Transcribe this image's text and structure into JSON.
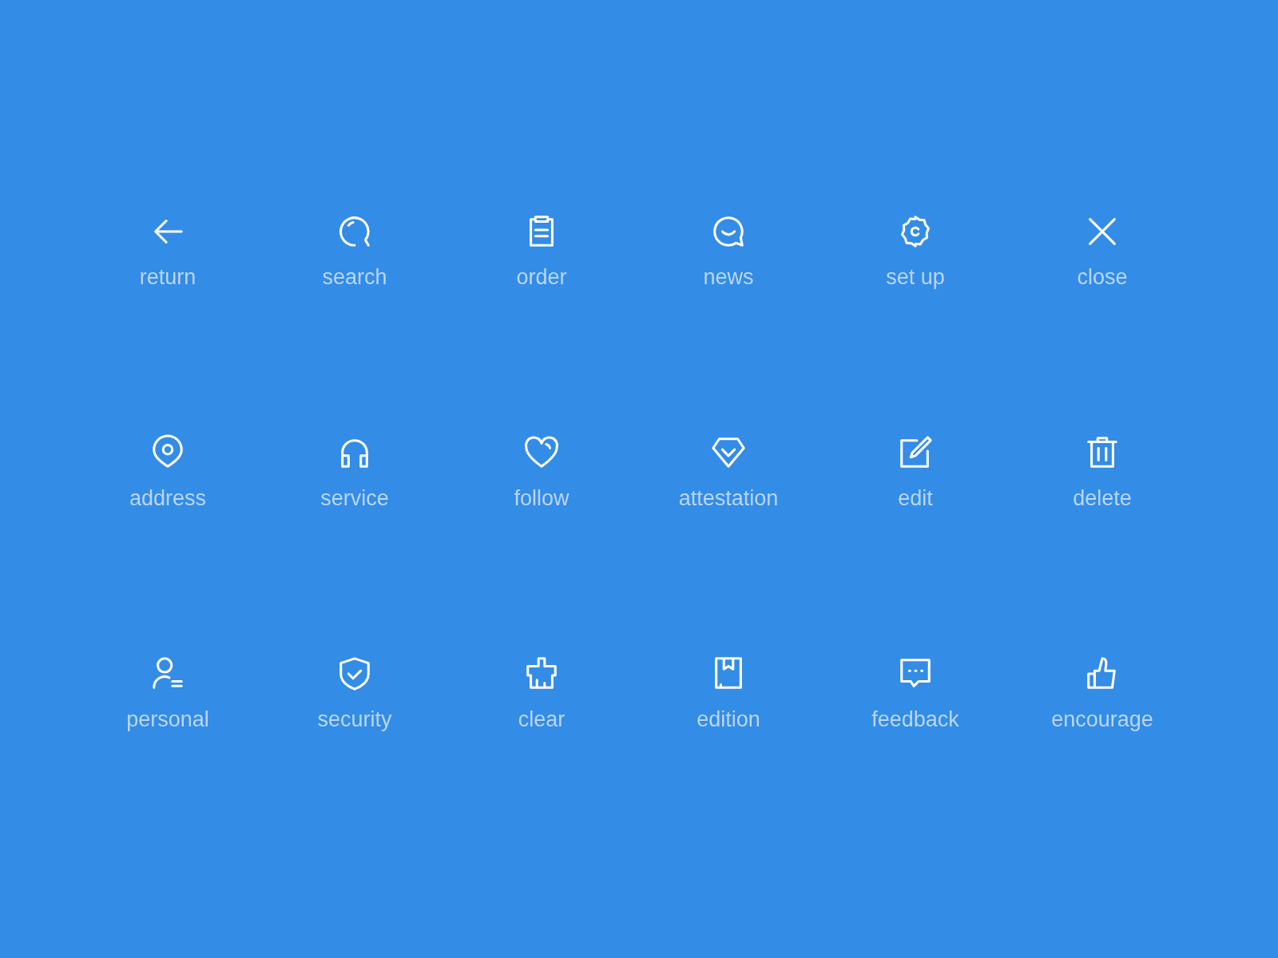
{
  "icons": [
    {
      "label": "return",
      "kind": "return"
    },
    {
      "label": "search",
      "kind": "search"
    },
    {
      "label": "order",
      "kind": "order"
    },
    {
      "label": "news",
      "kind": "news"
    },
    {
      "label": "set up",
      "kind": "setup"
    },
    {
      "label": "close",
      "kind": "close"
    },
    {
      "label": "address",
      "kind": "address"
    },
    {
      "label": "service",
      "kind": "service"
    },
    {
      "label": "follow",
      "kind": "follow"
    },
    {
      "label": "attestation",
      "kind": "attestation"
    },
    {
      "label": "edit",
      "kind": "edit"
    },
    {
      "label": "delete",
      "kind": "delete"
    },
    {
      "label": "personal",
      "kind": "personal"
    },
    {
      "label": "security",
      "kind": "security"
    },
    {
      "label": "clear",
      "kind": "clear"
    },
    {
      "label": "edition",
      "kind": "edition"
    },
    {
      "label": "feedback",
      "kind": "feedback"
    },
    {
      "label": "encourage",
      "kind": "encourage"
    }
  ]
}
